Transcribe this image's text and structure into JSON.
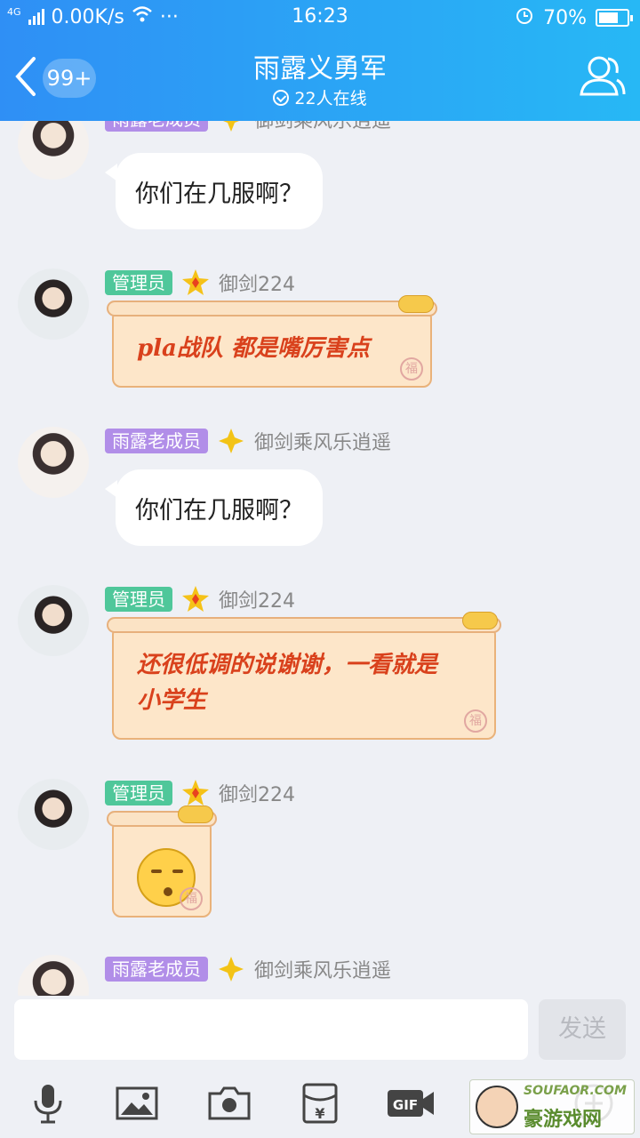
{
  "status_bar": {
    "network": "4G",
    "speed": "0.00K/s",
    "more": "···",
    "time": "16:23",
    "battery_pct": "70%",
    "battery_level": 0.7
  },
  "header": {
    "unread_badge": "99+",
    "title": "雨露义勇军",
    "online": "22人在线"
  },
  "messages": [
    {
      "role": "雨露老成员",
      "nick": "御剑乘风乐逍遥",
      "text": "你们在几服啊？"
    },
    {
      "role": "管理员",
      "nick": "御剑224",
      "text": "pla战队 都是嘴厉害点"
    },
    {
      "role": "雨露老成员",
      "nick": "御剑乘风乐逍遥",
      "text": "你们在几服啊？"
    },
    {
      "role": "管理员",
      "nick": "御剑224",
      "text": "还很低调的说谢谢，一看就是小学生"
    },
    {
      "role": "管理员",
      "nick": "御剑224",
      "text": ""
    },
    {
      "role": "雨露老成员",
      "nick": "御剑乘风乐逍遥",
      "text": ""
    }
  ],
  "seal_char": "福",
  "input": {
    "placeholder": "",
    "send_label": "发送"
  },
  "toolbar": {
    "gif_label": "GIF",
    "yen_label": "¥"
  },
  "watermark": {
    "line1": "SOUFAOR.COM",
    "line2": "豪游戏网"
  }
}
